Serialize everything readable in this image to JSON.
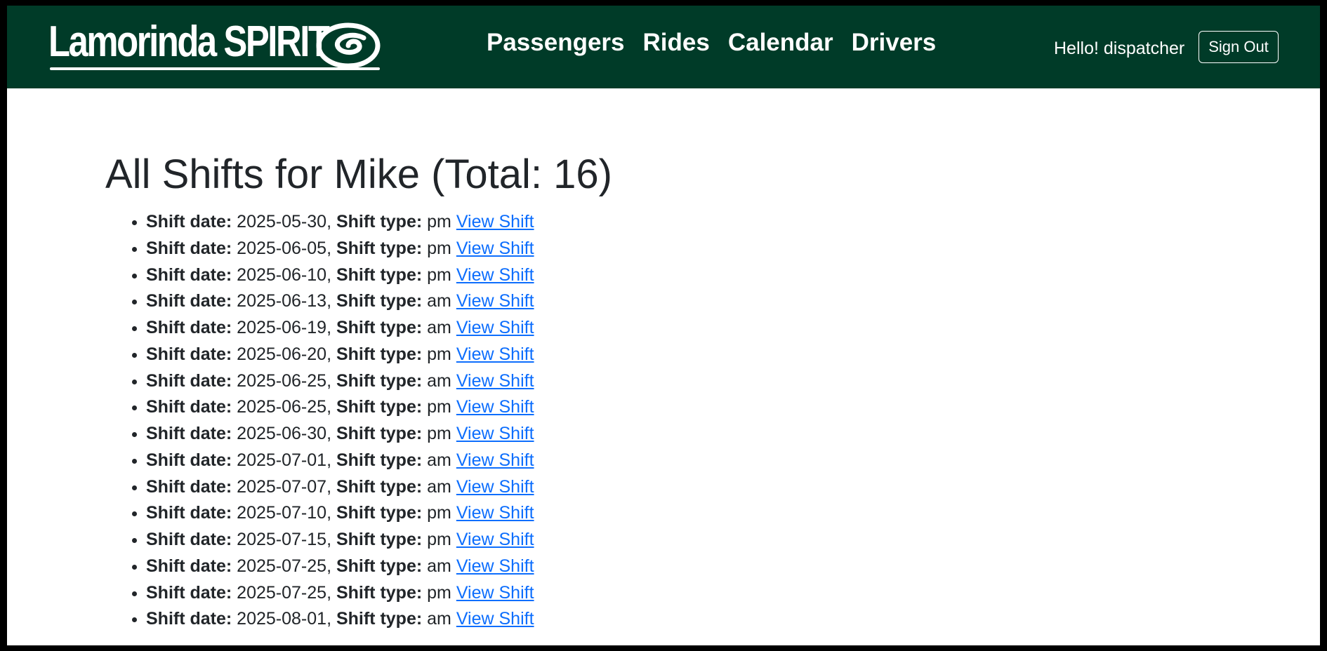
{
  "header": {
    "brand": "Lamorinda SPIRIT",
    "nav": [
      "Passengers",
      "Rides",
      "Calendar",
      "Drivers"
    ],
    "greeting": "Hello! dispatcher",
    "sign_out_label": "Sign Out"
  },
  "page": {
    "title": "All Shifts for Mike (Total: 16)",
    "date_label": "Shift date:",
    "type_label": "Shift type:",
    "link_label": "View Shift",
    "shifts": [
      {
        "date": "2025-05-30",
        "type": "pm"
      },
      {
        "date": "2025-06-05",
        "type": "pm"
      },
      {
        "date": "2025-06-10",
        "type": "pm"
      },
      {
        "date": "2025-06-13",
        "type": "am"
      },
      {
        "date": "2025-06-19",
        "type": "am"
      },
      {
        "date": "2025-06-20",
        "type": "pm"
      },
      {
        "date": "2025-06-25",
        "type": "am"
      },
      {
        "date": "2025-06-25",
        "type": "pm"
      },
      {
        "date": "2025-06-30",
        "type": "pm"
      },
      {
        "date": "2025-07-01",
        "type": "am"
      },
      {
        "date": "2025-07-07",
        "type": "am"
      },
      {
        "date": "2025-07-10",
        "type": "pm"
      },
      {
        "date": "2025-07-15",
        "type": "pm"
      },
      {
        "date": "2025-07-25",
        "type": "am"
      },
      {
        "date": "2025-07-25",
        "type": "pm"
      },
      {
        "date": "2025-08-01",
        "type": "am"
      }
    ]
  },
  "colors": {
    "navbar": "#003b28",
    "link": "#0d6efd",
    "text": "#212529"
  },
  "icons": {
    "brand_swirl": "spiral-logo-icon"
  }
}
